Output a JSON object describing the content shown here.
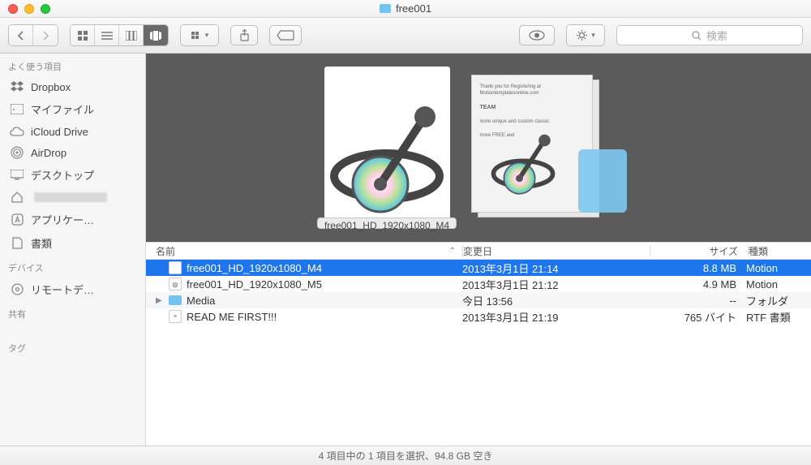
{
  "window": {
    "title": "free001"
  },
  "toolbar": {
    "search_placeholder": "検索"
  },
  "sidebar": {
    "sections": {
      "favorites": "よく使う項目",
      "devices": "デバイス",
      "shared": "共有",
      "tags": "タグ"
    },
    "items": [
      {
        "label": "Dropbox",
        "icon": "dropbox-icon"
      },
      {
        "label": "マイファイル",
        "icon": "myfiles-icon"
      },
      {
        "label": "iCloud Drive",
        "icon": "icloud-icon"
      },
      {
        "label": "AirDrop",
        "icon": "airdrop-icon"
      },
      {
        "label": "デスクトップ",
        "icon": "desktop-icon"
      },
      {
        "label": "",
        "icon": "home-icon"
      },
      {
        "label": "アプリケー…",
        "icon": "apps-icon"
      },
      {
        "label": "書類",
        "icon": "documents-icon"
      }
    ],
    "device_items": [
      {
        "label": "リモートデ…",
        "icon": "disc-icon"
      }
    ]
  },
  "preview": {
    "caption": "free001_HD_1920x1080_M4",
    "stack_text_title": "Thank you for Registering at Motiontemplatesonline.com",
    "stack_text_sub1": "TEAM",
    "stack_text_sub2": "more unique and custom classic",
    "stack_text_sub3": "more FREE and"
  },
  "columns": {
    "name": "名前",
    "date": "変更日",
    "size": "サイズ",
    "kind": "種類"
  },
  "rows": [
    {
      "name": "free001_HD_1920x1080_M4",
      "date": "2013年3月1日 21:14",
      "size": "8.8 MB",
      "kind": "Motion",
      "selected": true,
      "type": "file"
    },
    {
      "name": "free001_HD_1920x1080_M5",
      "date": "2013年3月1日 21:12",
      "size": "4.9 MB",
      "kind": "Motion",
      "selected": false,
      "type": "file"
    },
    {
      "name": "Media",
      "date": "今日 13:56",
      "size": "--",
      "kind": "フォルダ",
      "selected": false,
      "type": "folder"
    },
    {
      "name": "READ ME FIRST!!!",
      "date": "2013年3月1日 21:19",
      "size": "765 バイト",
      "kind": "RTF 書類",
      "selected": false,
      "type": "file"
    }
  ],
  "status": "4 項目中の 1 項目を選択、94.8 GB 空き"
}
